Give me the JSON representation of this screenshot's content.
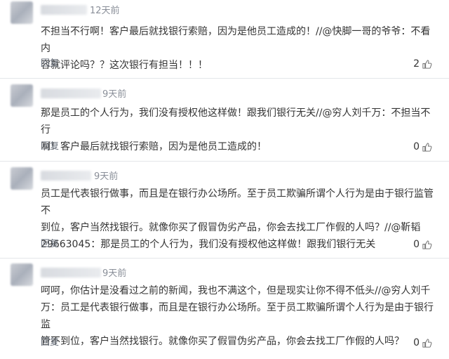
{
  "comments": [
    {
      "time": "12天前",
      "text": "不担当不行啊！客户最后就找银行索赔，因为是他员工造成的！//@快脚一哥的爷爷：不看内\n容就评论吗？？这次银行有担当！！！",
      "reply_label": "回复",
      "likes": "2"
    },
    {
      "time": "9天前",
      "text": "那是员工的个人行为，我们没有授权他这样做！跟我们银行无关//@穷人刘千万：不担当不行\n啊！客户最后就找银行索赔，因为是他员工造成的！",
      "reply_label": "回复",
      "likes": "0"
    },
    {
      "time": "9天前",
      "text": "员工是代表银行做事，而且是在银行办公场所。至于员工欺骗所谓个人行为是由于银行监管不\n到位，客户当然找银行。就像你买了假冒伪劣产品，你会去找工厂作假的人吗？//@靳韬\n29663045：那是员工的个人行为，我们没有授权他这样做！跟我们银行无关",
      "reply_label": "回复",
      "likes": "0"
    },
    {
      "time": "9天前",
      "text": "呵呵，你估计是没看过之前的新闻，我也不满这个，但是现实让你不得不低头//@穷人刘千\n万：员工是代表银行做事，而且是在银行办公场所。至于员工欺骗所谓个人行为是由于银行监\n管不到位，客户当然找银行。就像你买了假冒伪劣产品，你会去找工厂作假的人吗？",
      "reply_label": "回复",
      "likes": "0"
    }
  ]
}
